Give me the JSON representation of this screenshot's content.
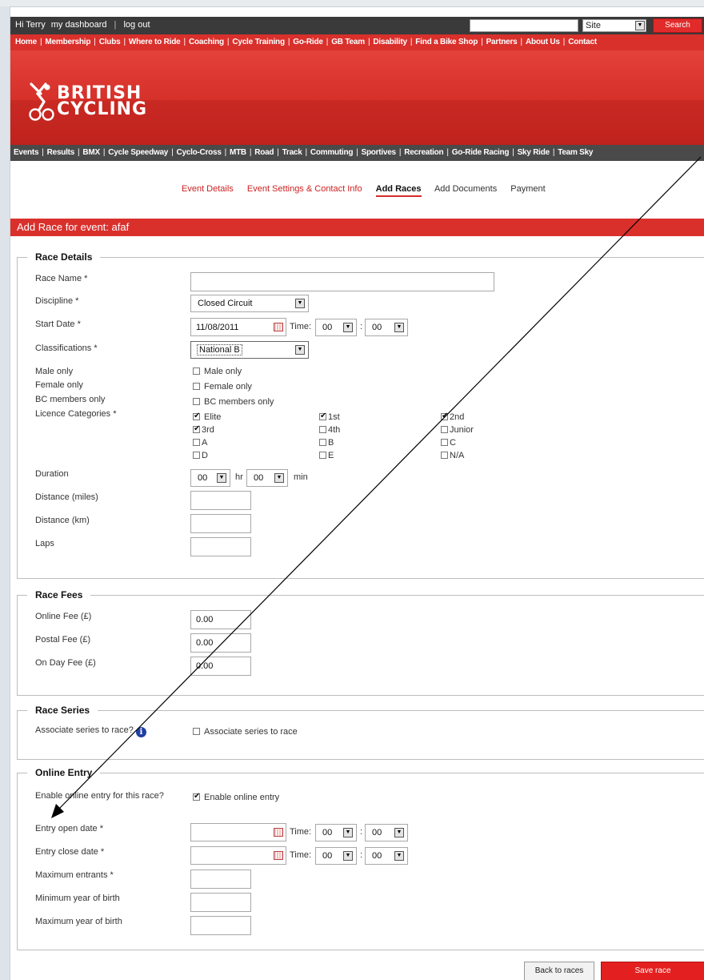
{
  "topbar": {
    "greeting": "Hi Terry",
    "dashboard": "my dashboard",
    "sep": "|",
    "logout": "log out",
    "search_value": "",
    "site_select": "Site",
    "search_button": "Search"
  },
  "main_nav": [
    "Home",
    "Membership",
    "Clubs",
    "Where to Ride",
    "Coaching",
    "Cycle Training",
    "Go-Ride",
    "GB Team",
    "Disability",
    "Find a Bike Shop",
    "Partners",
    "About Us",
    "Contact"
  ],
  "logo": {
    "line1": "BRITISH",
    "line2": "CYCLING"
  },
  "sub_nav": [
    "Events",
    "Results",
    "BMX",
    "Cycle Speedway",
    "Cyclo-Cross",
    "MTB",
    "Road",
    "Track",
    "Commuting",
    "Sportives",
    "Recreation",
    "Go-Ride Racing",
    "Sky Ride",
    "Team Sky"
  ],
  "steps": {
    "event_details": "Event Details",
    "event_settings": "Event Settings & Contact Info",
    "add_races": "Add Races",
    "add_documents": "Add Documents",
    "payment": "Payment"
  },
  "page_title": "Add Race for event: afaf",
  "race_details": {
    "legend": "Race Details",
    "race_name_label": "Race Name *",
    "race_name_value": "",
    "discipline_label": "Discipline *",
    "discipline_value": "Closed Circuit",
    "start_date_label": "Start Date *",
    "start_date_value": "11/08/2011",
    "time_label": "Time:",
    "colon": ":",
    "start_hour": "00",
    "start_min": "00",
    "classifications_label": "Classifications *",
    "classifications_value": "National B",
    "male_label": "Male only",
    "male_check": "Male only",
    "female_label": "Female only",
    "female_check": "Female only",
    "bc_label": "BC members only",
    "bc_check": "BC members only",
    "licence_label": "Licence Categories *",
    "licence": {
      "elite": "Elite",
      "first": "1st",
      "second": "2nd",
      "third": "3rd",
      "fourth": "4th",
      "junior": "Junior",
      "a": "A",
      "b": "B",
      "c": "C",
      "d": "D",
      "e": "E",
      "na": "N/A"
    },
    "duration_label": "Duration",
    "duration_hr": "00",
    "hr": "hr",
    "duration_min": "00",
    "min": "min",
    "distance_miles_label": "Distance (miles)",
    "distance_km_label": "Distance (km)",
    "laps_label": "Laps"
  },
  "race_fees": {
    "legend": "Race Fees",
    "online_label": "Online Fee (£)",
    "online_value": "0.00",
    "postal_label": "Postal Fee (£)",
    "postal_value": "0.00",
    "onday_label": "On Day Fee (£)",
    "onday_value": "0.00"
  },
  "race_series": {
    "legend": "Race Series",
    "associate_label": "Associate series to race?",
    "info_icon": "i",
    "associate_check": "Associate series to race"
  },
  "online_entry": {
    "legend": "Online Entry",
    "enable_label": "Enable online entry for this race?",
    "enable_check": "Enable online entry",
    "open_label": "Entry open date *",
    "close_label": "Entry close date *",
    "time_label": "Time:",
    "colon": ":",
    "hour": "00",
    "minute": "00",
    "max_entrants_label": "Maximum entrants *",
    "min_year_label": "Minimum year of birth",
    "max_year_label": "Maximum year of birth"
  },
  "buttons": {
    "back": "Back to races",
    "save": "Save race"
  },
  "colors": {
    "brand_red": "#d9302c",
    "dark_bar": "#3a3a3a",
    "subnav": "#4a4a4a",
    "info_blue": "#1f3fa3"
  }
}
